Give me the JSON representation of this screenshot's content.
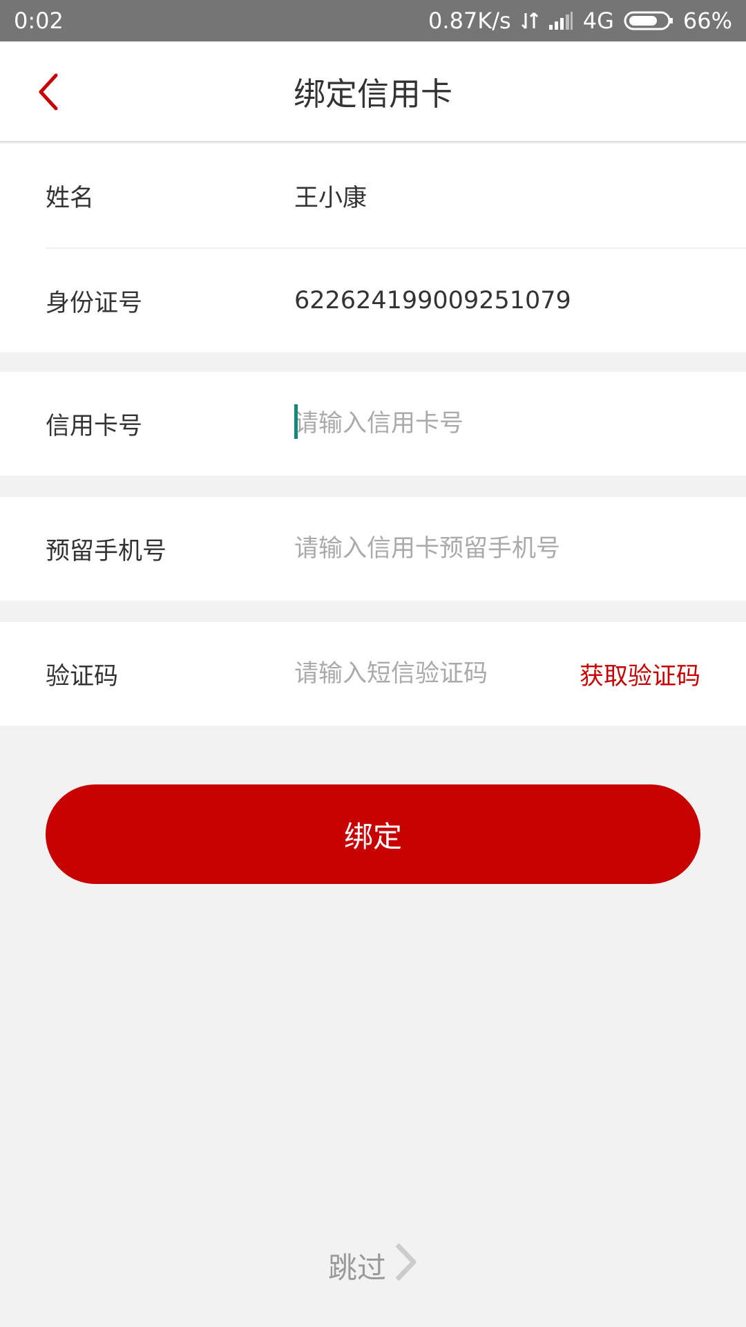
{
  "status_bar": {
    "time": "0:02",
    "net_speed": "0.87K/s",
    "network": "4G",
    "battery": "66%"
  },
  "nav": {
    "title": "绑定信用卡",
    "back_icon": "chevron-left-icon"
  },
  "form": {
    "name_label": "姓名",
    "name_value": "王小康",
    "id_label": "身份证号",
    "id_value": "622624199009251079",
    "card_label": "信用卡号",
    "card_placeholder": "请输入信用卡号",
    "phone_label": "预留手机号",
    "phone_placeholder": "请输入信用卡预留手机号",
    "code_label": "验证码",
    "code_placeholder": "请输入短信验证码",
    "get_code": "获取验证码"
  },
  "bind_button": "绑定",
  "skip_label": "跳过",
  "colors": {
    "accent": "#c70000",
    "background": "#f2f2f2",
    "status_bar": "#757575",
    "cursor": "#12877a"
  }
}
